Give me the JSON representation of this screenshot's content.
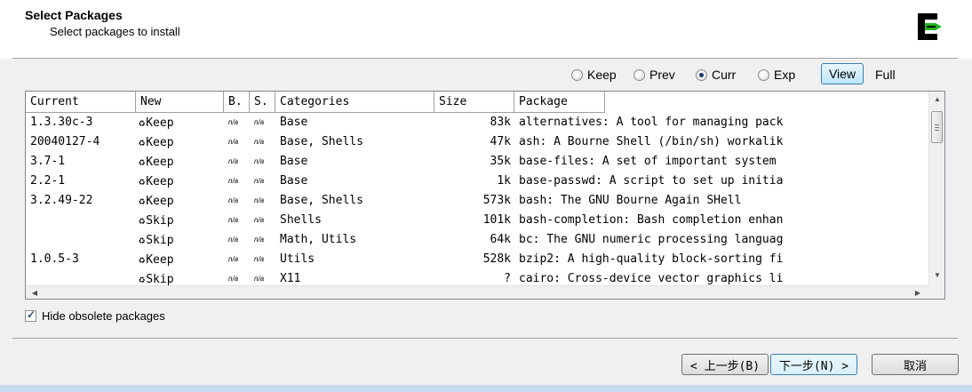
{
  "header": {
    "title": "Select Packages",
    "subtitle": "Select packages to install"
  },
  "view_options": {
    "radios": [
      {
        "label": "Keep",
        "checked": false
      },
      {
        "label": "Prev",
        "checked": false
      },
      {
        "label": "Curr",
        "checked": true
      },
      {
        "label": "Exp",
        "checked": false
      }
    ],
    "view_button": "View",
    "view_mode": "Full"
  },
  "table": {
    "columns": [
      "Current",
      "New",
      "B.",
      "S.",
      "Categories",
      "Size",
      "Package"
    ],
    "rows": [
      {
        "current": "1.3.30c-3",
        "new": "Keep",
        "b": "n/a",
        "s": "n/a",
        "categories": "Base",
        "size": "83k",
        "package": "alternatives: A tool for managing pack"
      },
      {
        "current": "20040127-4",
        "new": "Keep",
        "b": "n/a",
        "s": "n/a",
        "categories": "Base, Shells",
        "size": "47k",
        "package": "ash: A Bourne Shell (/bin/sh) workalik"
      },
      {
        "current": "3.7-1",
        "new": "Keep",
        "b": "n/a",
        "s": "n/a",
        "categories": "Base",
        "size": "35k",
        "package": "base-files: A set of important system"
      },
      {
        "current": "2.2-1",
        "new": "Keep",
        "b": "n/a",
        "s": "n/a",
        "categories": "Base",
        "size": "1k",
        "package": "base-passwd: A script to set up initia"
      },
      {
        "current": "3.2.49-22",
        "new": "Keep",
        "b": "n/a",
        "s": "n/a",
        "categories": "Base, Shells",
        "size": "573k",
        "package": "bash: The GNU Bourne Again SHell"
      },
      {
        "current": "",
        "new": "Skip",
        "b": "n/a",
        "s": "n/a",
        "categories": "Shells",
        "size": "101k",
        "package": "bash-completion: Bash completion enhan"
      },
      {
        "current": "",
        "new": "Skip",
        "b": "n/a",
        "s": "n/a",
        "categories": "Math, Utils",
        "size": "64k",
        "package": "bc: The GNU numeric processing languag"
      },
      {
        "current": "1.0.5-3",
        "new": "Keep",
        "b": "n/a",
        "s": "n/a",
        "categories": "Utils",
        "size": "528k",
        "package": "bzip2: A high-quality block-sorting fi"
      },
      {
        "current": "",
        "new": "Skip",
        "b": "n/a",
        "s": "n/a",
        "categories": "X11",
        "size": "?",
        "package": "cairo: Cross-device vector graphics li"
      }
    ]
  },
  "options": {
    "hide_obsolete_label": "Hide obsolete packages",
    "hide_obsolete_checked": true
  },
  "buttons": {
    "back": "< 上一步(B)",
    "next": "下一步(N) >",
    "cancel": "取消"
  },
  "icons": {
    "logo": "cygwin-logo-icon",
    "cycle": "cycle-icon"
  },
  "colors": {
    "logo_green": "#21b421",
    "selected_border": "#3c7fb1"
  }
}
